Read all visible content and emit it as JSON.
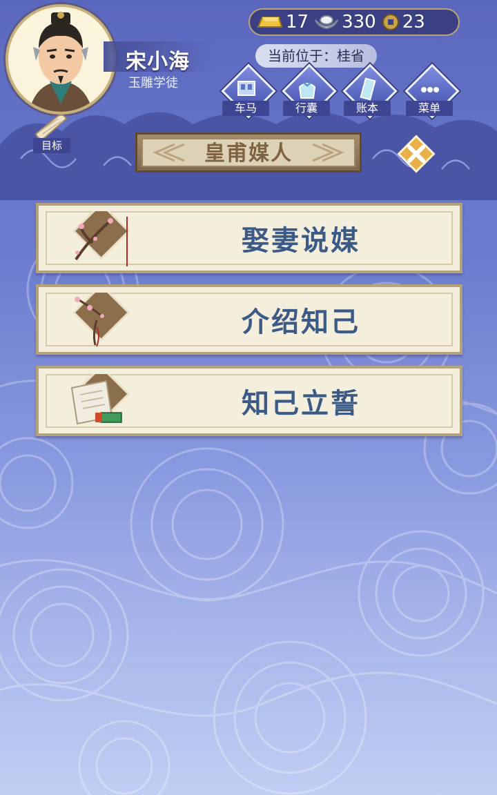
{
  "player": {
    "name": "宋小海",
    "title": "玉雕学徒"
  },
  "currency": {
    "gold": "17",
    "silver": "330",
    "coin": "23"
  },
  "location": {
    "label": "当前位于：桂省"
  },
  "nav": [
    {
      "label": "车马",
      "icon": "carriage-icon"
    },
    {
      "label": "行囊",
      "icon": "bag-icon"
    },
    {
      "label": "账本",
      "icon": "ledger-icon"
    },
    {
      "label": "菜单",
      "icon": "menu-dots-icon"
    }
  ],
  "goal": {
    "label": "目标"
  },
  "panel": {
    "title": "皇甫媒人"
  },
  "options": [
    {
      "label": "娶妻说媒",
      "icon": "plum-blossom-icon"
    },
    {
      "label": "介绍知己",
      "icon": "plum-blossom-icon"
    },
    {
      "label": "知己立誓",
      "icon": "scroll-seal-icon"
    }
  ],
  "colors": {
    "primary": "#3e4593",
    "card_text": "#3b5a86",
    "banner_text": "#7d6344"
  }
}
